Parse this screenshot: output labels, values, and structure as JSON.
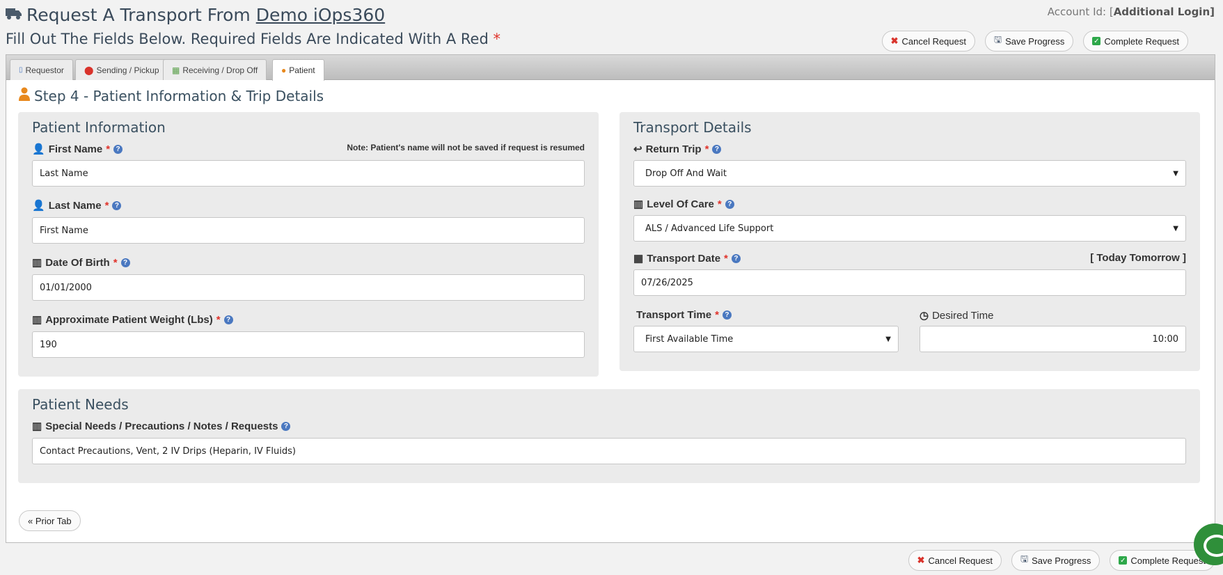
{
  "header": {
    "title_prefix": "Request A Transport From",
    "title_link": "Demo iOps360",
    "account_prefix": "Account Id: [",
    "account_link": "Additional Login]",
    "subtitle": "Fill Out The Fields Below. Required Fields Are Indicated With A Red",
    "required_marker": "*"
  },
  "actions": {
    "cancel": "Cancel Request",
    "save": "Save Progress",
    "complete": "Complete Request",
    "complete_bottom": "Complete Request"
  },
  "tabs": [
    {
      "label": "Requestor",
      "icon": "mobile-icon"
    },
    {
      "label": "Sending / Pickup",
      "icon": "map-marker-icon"
    },
    {
      "label": "Receiving / Drop Off",
      "icon": "map-icon"
    },
    {
      "label": "Patient",
      "icon": "user-icon"
    }
  ],
  "step_title": "Step 4 - Patient Information & Trip Details",
  "patient_info": {
    "title": "Patient Information",
    "note": "Note: Patient's name will not be saved if request is resumed",
    "first_name_label": "First Name",
    "first_name_value": "Last Name",
    "last_name_label": "Last Name",
    "last_name_value": "First Name",
    "dob_label": "Date Of Birth",
    "dob_value": "01/01/2000",
    "weight_label": "Approximate Patient Weight (Lbs)",
    "weight_value": "190"
  },
  "transport_details": {
    "title": "Transport Details",
    "return_trip_label": "Return Trip",
    "return_trip_value": "Drop Off And Wait",
    "level_of_care_label": "Level Of Care",
    "level_of_care_value": "ALS / Advanced Life Support",
    "transport_date_label": "Transport Date",
    "transport_date_value": "07/26/2025",
    "quick_dates": "[ Today  Tomorrow ]",
    "transport_time_label": "Transport Time",
    "transport_time_value": "First Available Time",
    "desired_time_label": "Desired Time",
    "desired_time_value": "10:00"
  },
  "patient_needs": {
    "title": "Patient Needs",
    "label": "Special Needs / Precautions / Notes / Requests",
    "value": "Contact Precautions,  Vent, 2 IV Drips (Heparin, IV Fluids)"
  },
  "prior_tab": "« Prior Tab",
  "colors": {
    "required": "#e0332b",
    "accent_orange": "#e8891e",
    "help_blue": "#4a78c0",
    "complete_green": "#2ea84a"
  }
}
